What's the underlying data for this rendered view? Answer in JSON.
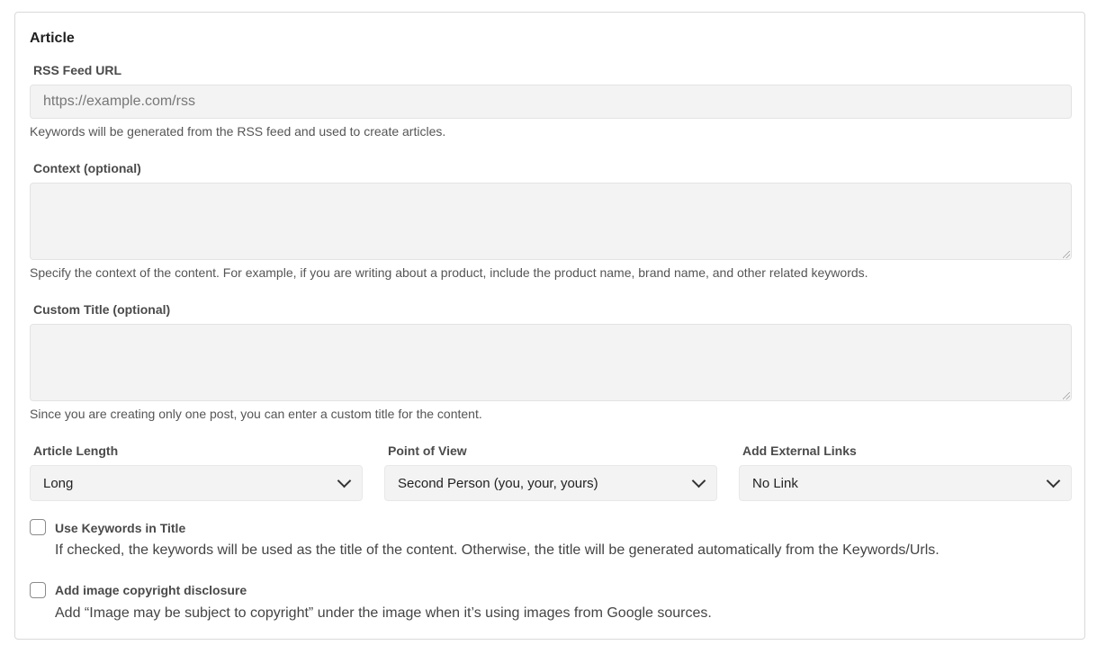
{
  "article": {
    "title": "Article",
    "rss": {
      "label": "RSS Feed URL",
      "placeholder": "https://example.com/rss",
      "value": "",
      "help": "Keywords will be generated from the RSS feed and used to create articles."
    },
    "context": {
      "label": "Context (optional)",
      "value": "",
      "help": "Specify the context of the content. For example, if you are writing about a product, include the product name, brand name, and other related keywords."
    },
    "custom_title": {
      "label": "Custom Title (optional)",
      "value": "",
      "help": "Since you are creating only one post, you can enter a custom title for the content."
    },
    "article_length": {
      "label": "Article Length",
      "selected": "Long"
    },
    "point_of_view": {
      "label": "Point of View",
      "selected": "Second Person (you, your, yours)"
    },
    "external_links": {
      "label": "Add External Links",
      "selected": "No Link"
    },
    "use_keywords": {
      "label": "Use Keywords in Title",
      "checked": false,
      "description": "If checked, the keywords will be used as the title of the content. Otherwise, the title will be generated automatically from the Keywords/Urls."
    },
    "image_copyright": {
      "label": "Add image copyright disclosure",
      "checked": false,
      "description": "Add “Image may be subject to copyright” under the image when it’s using images from Google sources."
    }
  }
}
